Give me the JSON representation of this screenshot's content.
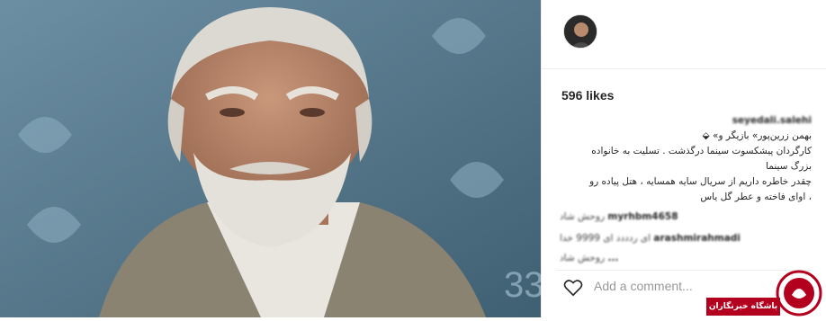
{
  "post": {
    "likes": "596 likes",
    "caption_user": "seyedali.salehi",
    "caption_lines": [
      "بهمن زرین‌پور» بازیگر و» ⬙",
      "کارگردان پیشکسوت سینما درگذشت . تسلیت به خانواده",
      "بزرگ سینما",
      "چقدر خاطره داریم از سریال سایه همسایه ، هتل پیاده رو",
      "، اوای فاخته و عطر گل یاس"
    ]
  },
  "comments": [
    {
      "user": "myrhbm4658",
      "text": "روحش شاد"
    },
    {
      "user": "arashmirahmadi",
      "text": "ای ردددد ای 9999 خدا"
    },
    {
      "user": "...",
      "text": "روحش شاد"
    }
  ],
  "footer": {
    "add_comment_placeholder": "Add a comment..."
  },
  "watermark": {
    "label": "باشگاه خبرنگاران",
    "color": "#b3001f"
  },
  "icons": {
    "like": "heart-icon",
    "avatar": "profile-avatar"
  }
}
